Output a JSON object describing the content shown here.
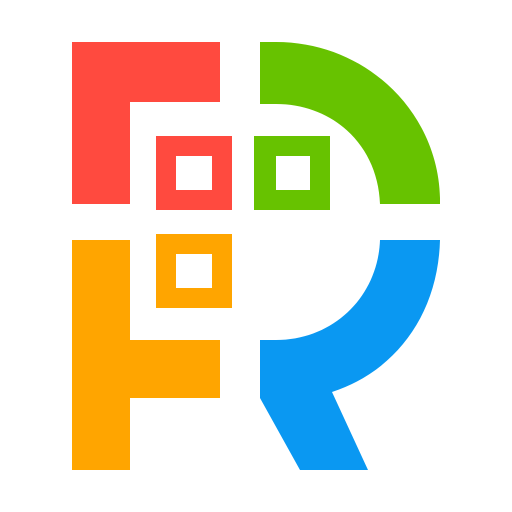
{
  "logo": {
    "icon_name": "four-color-fr-logo-icon",
    "colors": {
      "red": "#FF4A3F",
      "green": "#67C200",
      "orange": "#FFA500",
      "blue": "#0A98F2",
      "background": "#FFFFFF"
    }
  }
}
